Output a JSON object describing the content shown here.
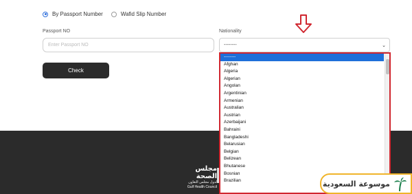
{
  "search_type": {
    "options": [
      {
        "label": "By Passport Number",
        "selected": true
      },
      {
        "label": "Wafid Slip Number",
        "selected": false
      }
    ]
  },
  "passport": {
    "label": "Passport NO",
    "placeholder": "Enter Passport NO"
  },
  "nationality": {
    "label": "Nationality",
    "selected_value": "--------",
    "options": [
      "--------",
      "Afghan",
      "Algeria",
      "Algerian",
      "Angolan",
      "Argentinian",
      "Armenian",
      "Australian",
      "Austrian",
      "Azerbaijani",
      "Bahraini",
      "Bangladeshi",
      "Belarusian",
      "Belgian",
      "Belizean",
      "Bhutanese",
      "Bosnian",
      "Brazilian"
    ]
  },
  "check_button": {
    "label": "Check"
  },
  "footer": {
    "logo_ar": "مجلس الصحة",
    "logo_ar_sub": "لدول مجلس التعاون",
    "logo_en": "Gulf Health Council"
  },
  "watermark": {
    "text": "موسوعة السعودية"
  },
  "colors": {
    "accent": "#1e6fd9",
    "highlight_border": "#d0262f",
    "footer_bg": "#2b2b2b",
    "button_bg": "#2b2b2b",
    "watermark_border": "#f0b429"
  },
  "icons": {
    "arrow": "arrow-down-icon",
    "chevron": "chevron-down-icon",
    "palm": "palm-tree-icon"
  }
}
